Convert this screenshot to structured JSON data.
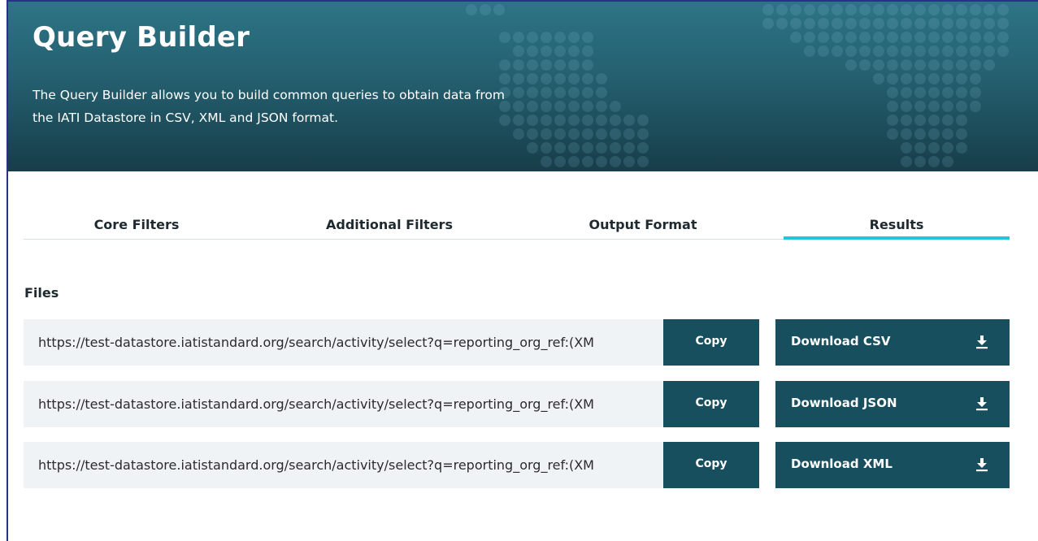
{
  "hero": {
    "title": "Query Builder",
    "description": "The Query Builder allows you to build common queries to obtain data from the IATI Datastore in CSV, XML and JSON format."
  },
  "tabs": [
    {
      "label": "Core Filters",
      "active": false
    },
    {
      "label": "Additional Filters",
      "active": false
    },
    {
      "label": "Output Format",
      "active": false
    },
    {
      "label": "Results",
      "active": true
    }
  ],
  "files": {
    "label": "Files",
    "rows": [
      {
        "url": "https://test-datastore.iatistandard.org/search/activity/select?q=reporting_org_ref:(XM",
        "copy_label": "Copy",
        "download_label": "Download CSV",
        "download_icon": "download-icon"
      },
      {
        "url": "https://test-datastore.iatistandard.org/search/activity/select?q=reporting_org_ref:(XM",
        "copy_label": "Copy",
        "download_label": "Download JSON",
        "download_icon": "download-icon"
      },
      {
        "url": "https://test-datastore.iatistandard.org/search/activity/select?q=reporting_org_ref:(XM",
        "copy_label": "Copy",
        "download_label": "Download XML",
        "download_icon": "download-icon"
      }
    ]
  },
  "colors": {
    "hero_top": "#2d7586",
    "hero_bottom": "#173d49",
    "button": "#174f5f",
    "tab_active_underline": "#1fc8d9",
    "url_field_bg": "#eff3f6"
  }
}
